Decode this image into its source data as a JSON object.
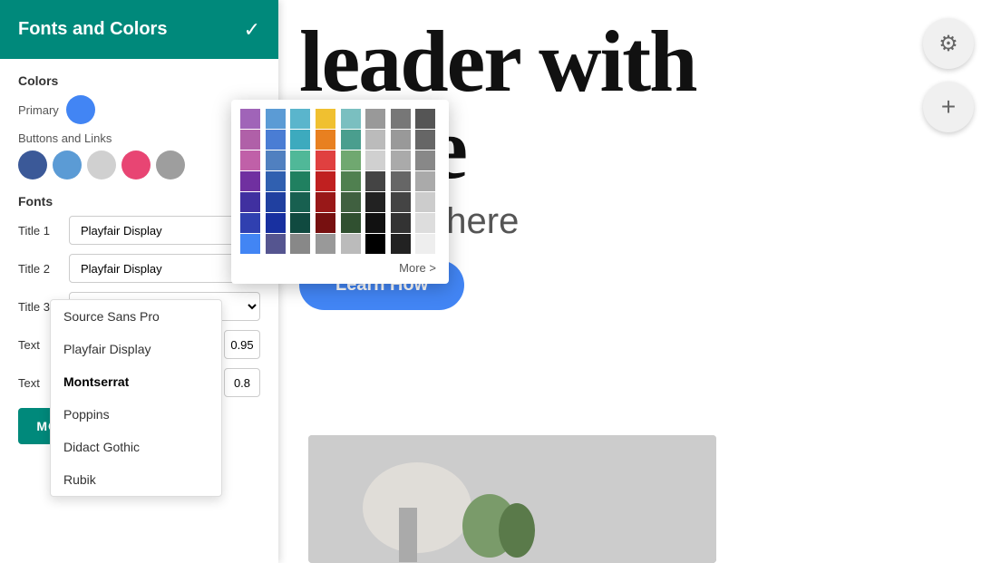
{
  "sidebar": {
    "title": "Fonts and Colors",
    "check_label": "✓",
    "colors_section": {
      "label": "Colors",
      "primary_label": "Primary",
      "primary_color": "#4285f4",
      "buttons_links_label": "Buttons and  Links",
      "swatches": [
        {
          "color": "#3b5998",
          "name": "dark-blue"
        },
        {
          "color": "#5b9bd5",
          "name": "medium-blue"
        },
        {
          "color": "#d0d0d0",
          "name": "light-gray"
        },
        {
          "color": "#e84573",
          "name": "pink"
        },
        {
          "color": "#9e9e9e",
          "name": "gray"
        }
      ]
    },
    "fonts_section": {
      "label": "Fonts",
      "rows": [
        {
          "label": "Title 1",
          "font": "Playfair Display",
          "size": null
        },
        {
          "label": "Title 2",
          "font": "Playfair Display",
          "size": null
        },
        {
          "label": "Title 3",
          "font": "Montserrat",
          "size": null
        },
        {
          "label": "Text",
          "font": "Source Sans Pro",
          "size": "0.95"
        },
        {
          "label": "Text",
          "font": "Playfair Display",
          "size": "0.8"
        }
      ]
    },
    "more_fonts_label": "MORE FONTS"
  },
  "color_picker": {
    "more_label": "More >",
    "colors": [
      "#9c5fb5",
      "#4a90d9",
      "#5ab7d6",
      "#f0c430",
      "#6eb5c0",
      "#888888",
      "#666666",
      "#444444",
      "#b35fad",
      "#4a7fd4",
      "#3dabcc",
      "#ee8a2a",
      "#4a9e8e",
      "#aaaaaa",
      "#888888",
      "#555555",
      "#c46ab7",
      "#5b87c5",
      "#5dbba8",
      "#e74c4c",
      "#7fb87a",
      "#c8c8c8",
      "#aaaaaa",
      "#777777",
      "#6a3d9a",
      "#3c6db5",
      "#2e8b7a",
      "#c0392b",
      "#5a7f5a",
      "#333333",
      "#555555",
      "#999999",
      "#4535aa",
      "#2c4ea0",
      "#237060",
      "#aa2222",
      "#4a6a4a",
      "#2a2a2a",
      "#444444",
      "#bbbbbb",
      "#3b4bc0",
      "#233690",
      "#1a5a50",
      "#882222",
      "#3a5a3a",
      "#1a1a1a",
      "#333333",
      "#cccccc",
      "#4285f4",
      "#666699",
      "#777777",
      "#999999",
      "#bbbbbb",
      "#000000",
      "#222222",
      "#dddddd"
    ]
  },
  "font_dropdown": {
    "items": [
      {
        "label": "Source Sans Pro",
        "active": false
      },
      {
        "label": "Playfair Display",
        "active": false
      },
      {
        "label": "Montserrat",
        "active": true
      },
      {
        "label": "Poppins",
        "active": false
      },
      {
        "label": "Didact Gothic",
        "active": false
      },
      {
        "label": "Rubik",
        "active": false
      }
    ]
  },
  "hero": {
    "title_line1": "leader with",
    "title_line2": "nage",
    "subtitle": "r subtitle here",
    "learn_how_label": "Learn How"
  },
  "icons": {
    "gear": "⚙",
    "plus": "+"
  }
}
